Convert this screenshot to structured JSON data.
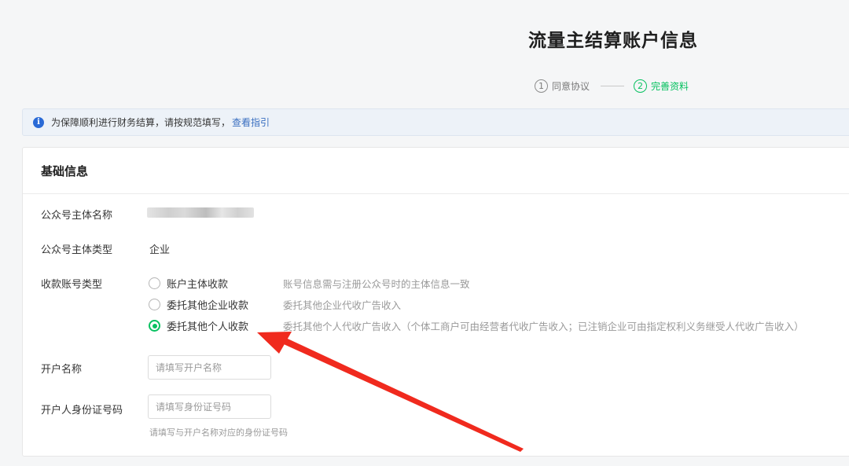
{
  "page_title": "流量主结算账户信息",
  "steps": [
    {
      "num": "1",
      "label": "同意协议"
    },
    {
      "num": "2",
      "label": "完善资料"
    }
  ],
  "notice": {
    "icon": "info-icon",
    "text": "为保障顺利进行财务结算，请按规范填写，",
    "link": "查看指引"
  },
  "card": {
    "title": "基础信息",
    "subject_name": {
      "label": "公众号主体名称"
    },
    "subject_type": {
      "label": "公众号主体类型",
      "value": "企业"
    },
    "account_type": {
      "label": "收款账号类型",
      "options": [
        {
          "label": "账户主体收款",
          "desc": "账号信息需与注册公众号时的主体信息一致",
          "checked": false
        },
        {
          "label": "委托其他企业收款",
          "desc": "委托其他企业代收广告收入",
          "checked": false
        },
        {
          "label": "委托其他个人收款",
          "desc": "委托其他个人代收广告收入（个体工商户可由经营者代收广告收入；已注销企业可由指定权利义务继受人代收广告收入）",
          "checked": true
        }
      ]
    },
    "account_name": {
      "label": "开户名称",
      "placeholder": "请填写开户名称"
    },
    "id_number": {
      "label": "开户人身份证号码",
      "placeholder": "请填写身份证号码",
      "hint": "请填写与开户名称对应的身份证号码"
    }
  },
  "colors": {
    "accent": "#07c160",
    "link": "#3a6fc0",
    "annotation_arrow": "#f02a1e"
  }
}
